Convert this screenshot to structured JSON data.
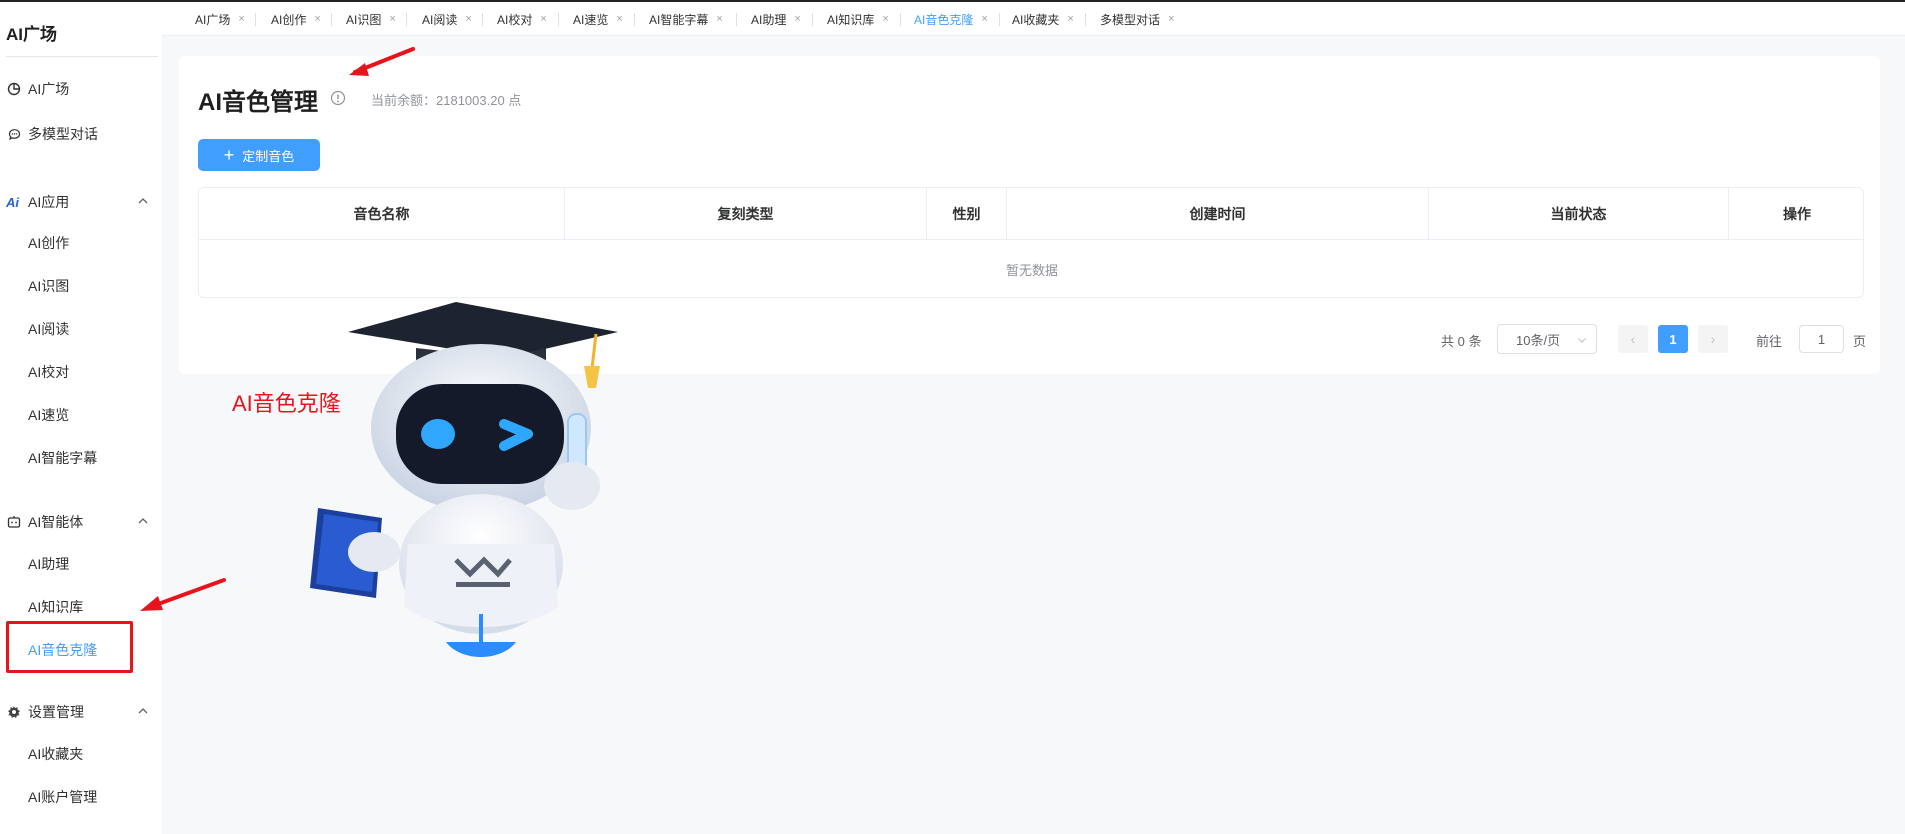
{
  "sidebar": {
    "brand": "AI广场",
    "items": [
      {
        "label": "AI广场",
        "icon": "pie-chart-icon"
      },
      {
        "label": "多模型对话",
        "icon": "chat-bubble-icon"
      }
    ],
    "groups": [
      {
        "label": "AI应用",
        "icon": "ai-logo-icon",
        "children": [
          "AI创作",
          "AI识图",
          "AI阅读",
          "AI校对",
          "AI速览",
          "AI智能字幕"
        ]
      },
      {
        "label": "AI智能体",
        "icon": "robot-icon",
        "children": [
          "AI助理",
          "AI知识库",
          "AI音色克隆"
        ]
      },
      {
        "label": "设置管理",
        "icon": "gear-icon",
        "children": [
          "AI收藏夹",
          "AI账户管理"
        ]
      }
    ],
    "active_item": "AI音色克隆"
  },
  "tabs": [
    {
      "label": "AI广场",
      "close": "×"
    },
    {
      "label": "AI创作",
      "close": "×"
    },
    {
      "label": "AI识图",
      "close": "×"
    },
    {
      "label": "AI阅读",
      "close": "×"
    },
    {
      "label": "AI校对",
      "close": "×"
    },
    {
      "label": "AI速览",
      "close": "×"
    },
    {
      "label": "AI智能字幕",
      "close": "×"
    },
    {
      "label": "AI助理",
      "close": "×"
    },
    {
      "label": "AI知识库",
      "close": "×"
    },
    {
      "label": "AI音色克隆",
      "close": "×"
    },
    {
      "label": "AI收藏夹",
      "close": "×"
    },
    {
      "label": "多模型对话",
      "close": "×"
    }
  ],
  "active_tab": "AI音色克隆",
  "main": {
    "title": "AI音色管理",
    "balance": "当前余额：2181003.20 点",
    "create_button": "定制音色",
    "table": {
      "columns": [
        "音色名称",
        "复刻类型",
        "性别",
        "创建时间",
        "当前状态",
        "操作"
      ],
      "rows": [],
      "empty_text": "暂无数据"
    },
    "pagination": {
      "total": "共 0 条",
      "page_size": "10条/页",
      "prev": "‹",
      "current_page": "1",
      "next": "›",
      "goto_label": "前往",
      "goto_value": "1",
      "page_suffix": "页"
    }
  },
  "annotation": {
    "label": "AI音色克隆",
    "color": "#e8141d"
  },
  "colors": {
    "accent": "#409eff",
    "annotation_red": "#e8141d"
  }
}
